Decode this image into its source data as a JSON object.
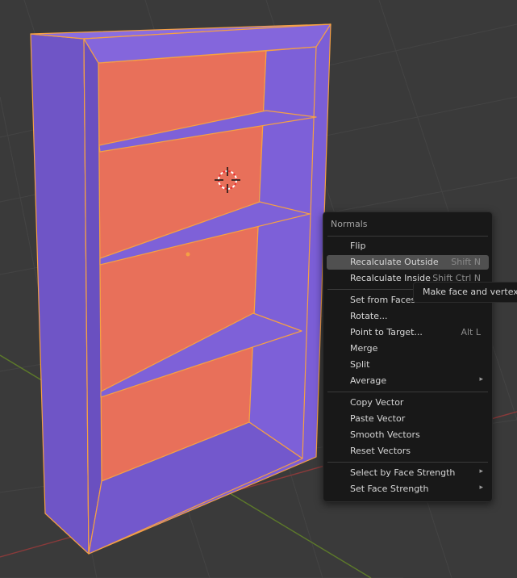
{
  "menu": {
    "title": "Normals",
    "items": [
      {
        "label": "Flip",
        "shortcut": ""
      },
      {
        "label": "Recalculate Outside",
        "shortcut": "Shift N"
      },
      {
        "label": "Recalculate Inside",
        "shortcut": "Shift Ctrl N"
      },
      {
        "label": "Set from Faces",
        "shortcut": ""
      },
      {
        "label": "Rotate...",
        "shortcut": ""
      },
      {
        "label": "Point to Target...",
        "shortcut": "Alt L"
      },
      {
        "label": "Merge",
        "shortcut": ""
      },
      {
        "label": "Split",
        "shortcut": ""
      },
      {
        "label": "Average",
        "shortcut": ""
      },
      {
        "label": "Copy Vector",
        "shortcut": ""
      },
      {
        "label": "Paste Vector",
        "shortcut": ""
      },
      {
        "label": "Smooth Vectors",
        "shortcut": ""
      },
      {
        "label": "Reset Vectors",
        "shortcut": ""
      },
      {
        "label": "Select by Face Strength",
        "shortcut": ""
      },
      {
        "label": "Set Face Strength",
        "shortcut": ""
      }
    ]
  },
  "tooltip": {
    "text": "Make face and vertex normals point outside"
  },
  "colors": {
    "viewport_bg": "#3a3a3a",
    "mesh_face": "#7b5ed6",
    "inner_back_face": "#e8705a",
    "edge_highlight": "#f5a044",
    "menu_bg": "#181818",
    "menu_highlight": "#505050"
  },
  "icons": {
    "submenu_arrow": "▸",
    "cursor": "3d-cursor-icon"
  }
}
